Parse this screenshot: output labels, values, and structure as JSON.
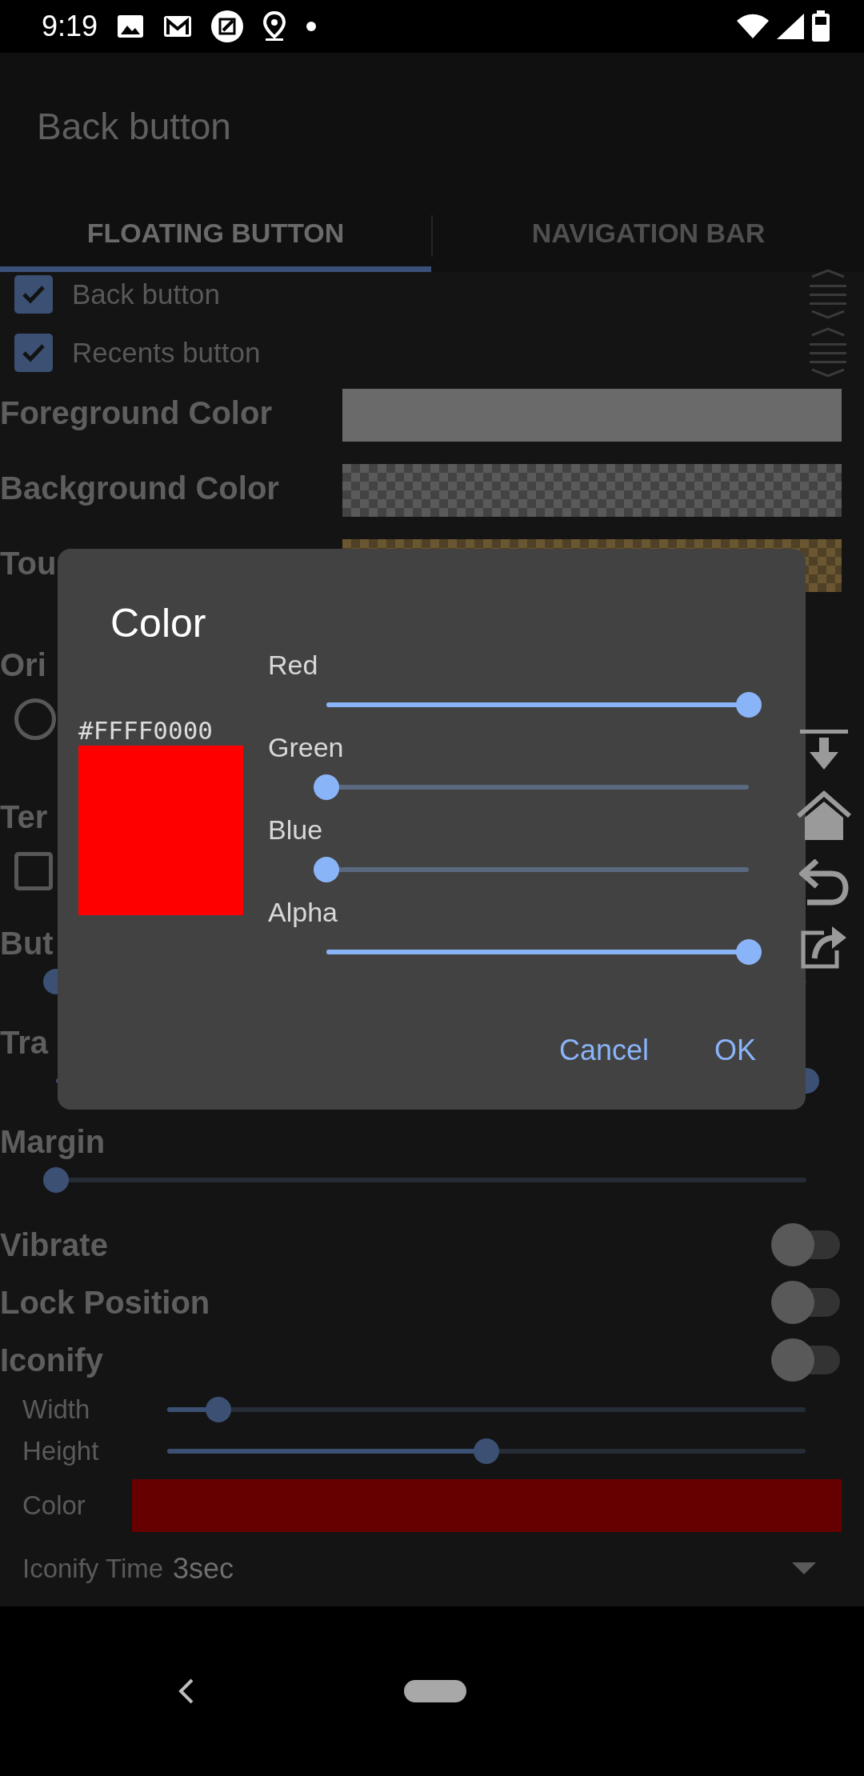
{
  "status_bar": {
    "time": "9:19"
  },
  "app_bar": {
    "title": "Back button"
  },
  "tabs": [
    {
      "label": "FLOATING BUTTON",
      "selected": true
    },
    {
      "label": "NAVIGATION BAR",
      "selected": false
    }
  ],
  "settings": [
    {
      "kind": "check",
      "label": "Back button",
      "checked": true
    },
    {
      "kind": "check",
      "label": "Recents button",
      "checked": true
    },
    {
      "kind": "color",
      "label": "Foreground Color",
      "color": "#6a6a6a",
      "checkered": false
    },
    {
      "kind": "color",
      "label": "Background Color",
      "color": "#5a5a5a",
      "checkered": true
    },
    {
      "kind": "color",
      "label": "Tou",
      "color": "#6b5632",
      "checkered": true
    },
    {
      "kind": "radio-group",
      "label": "Ori",
      "checked": false
    },
    {
      "kind": "check-group",
      "label": "Ter",
      "checked": false
    },
    {
      "kind": "slider",
      "label": "But",
      "level": 0
    },
    {
      "kind": "slider",
      "label": "Tra",
      "level": 1
    },
    {
      "kind": "slider",
      "label": "Margin",
      "level": 0
    },
    {
      "kind": "switch",
      "label": "Vibrate",
      "on": false
    },
    {
      "kind": "switch",
      "label": "Lock Position",
      "on": false
    },
    {
      "kind": "switch",
      "label": "Iconify",
      "on": false
    },
    {
      "kind": "sub-slider",
      "label": "Width",
      "level": 0.08
    },
    {
      "kind": "sub-slider",
      "label": "Height",
      "level": 0.5
    },
    {
      "kind": "sub-color",
      "label": "Color",
      "color": "#660000"
    },
    {
      "kind": "dropdown",
      "label": "Iconify Time",
      "value": "3sec"
    }
  ],
  "dialog": {
    "title": "Color",
    "hex": "#FFFF0000",
    "channels": [
      {
        "name": "Red",
        "level": 1
      },
      {
        "name": "Green",
        "level": 0
      },
      {
        "name": "Blue",
        "level": 0
      },
      {
        "name": "Alpha",
        "level": 1
      }
    ],
    "buttons": [
      "Cancel",
      "OK"
    ]
  }
}
